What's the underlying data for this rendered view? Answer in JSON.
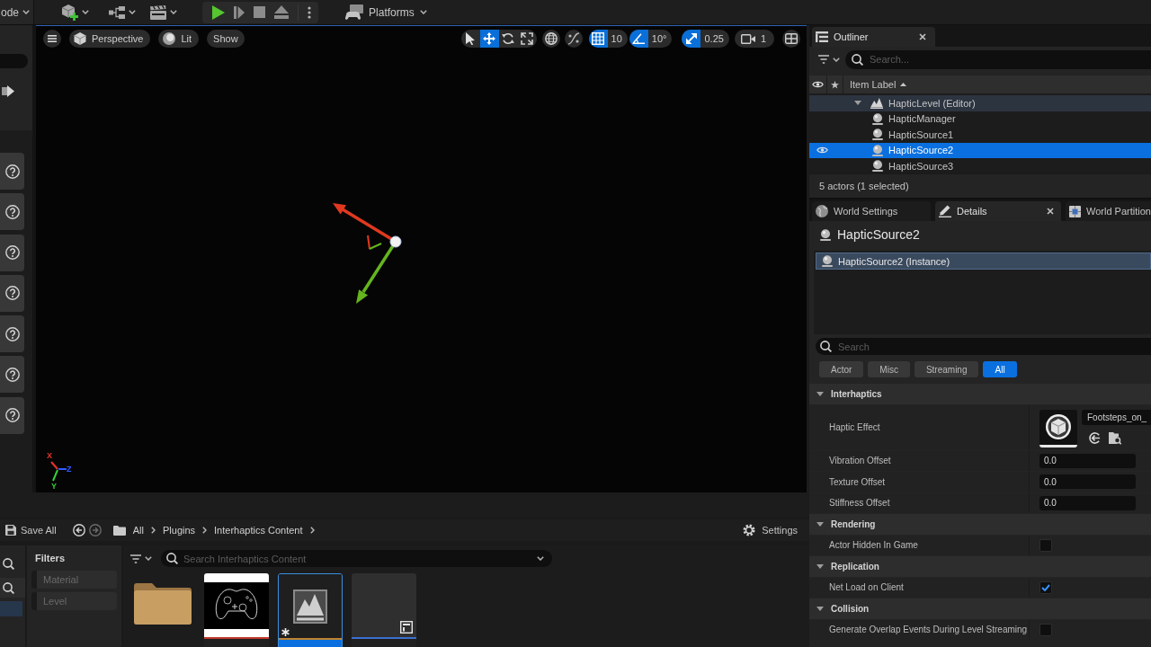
{
  "toolbar": {
    "mode_label": "ode",
    "platforms_label": "Platforms"
  },
  "place_actors": {
    "items": [
      {
        "kind": "help"
      },
      {
        "kind": "help"
      },
      {
        "kind": "help"
      },
      {
        "kind": "help"
      },
      {
        "kind": "help"
      },
      {
        "kind": "help"
      },
      {
        "kind": "help"
      }
    ]
  },
  "viewport": {
    "view_buttons": [
      {
        "kind": "perspective",
        "label": "Perspective"
      },
      {
        "kind": "lit",
        "label": "Lit"
      },
      {
        "kind": "show",
        "label": "Show"
      }
    ],
    "transform_tools": [
      {
        "kind": "select",
        "selected": false
      },
      {
        "kind": "translate",
        "selected": true
      },
      {
        "kind": "rotate",
        "selected": false
      },
      {
        "kind": "scale",
        "selected": false
      }
    ],
    "snaps": [
      {
        "kind": "grid",
        "on": true,
        "value": "10"
      },
      {
        "kind": "rotation",
        "on": true,
        "value": "10°"
      },
      {
        "kind": "scale",
        "on": true,
        "value": "0.25"
      }
    ],
    "camera_speed": "1",
    "axes": [
      {
        "label": "X",
        "color": "#e8322a"
      },
      {
        "label": "Z",
        "color": "#2f5bff"
      },
      {
        "label": "Y",
        "color": "#36d13a"
      }
    ]
  },
  "outliner": {
    "tabs": [
      {
        "label": "Outliner",
        "selected": true
      }
    ],
    "search": {
      "placeholder": "Search..."
    },
    "column": "Item Label",
    "sort_ascending": true,
    "tree": [
      {
        "label": "HapticLevel (Editor)",
        "kind": "level",
        "expanded": true,
        "selected": false,
        "children": [
          {
            "label": "HapticManager",
            "kind": "actor",
            "selected": false
          },
          {
            "label": "HapticSource1",
            "kind": "actor",
            "selected": false
          },
          {
            "label": "HapticSource2",
            "kind": "actor",
            "selected": true
          },
          {
            "label": "HapticSource3",
            "kind": "actor",
            "selected": false
          }
        ]
      }
    ],
    "status": "5 actors (1 selected)"
  },
  "details": {
    "tabs": [
      {
        "kind": "world_settings",
        "label": "World Settings",
        "selected": false
      },
      {
        "kind": "details",
        "label": "Details",
        "selected": true
      },
      {
        "kind": "world_partition",
        "label": "World Partition",
        "selected": false
      }
    ],
    "actor_name": "HapticSource2",
    "component": {
      "label": "HapticSource2 (Instance)",
      "selected": true
    },
    "search": {
      "placeholder": "Search"
    },
    "filters": [
      {
        "label": "Actor",
        "selected": false
      },
      {
        "label": "Misc",
        "selected": false
      },
      {
        "label": "Streaming",
        "selected": false
      },
      {
        "label": "All",
        "selected": true
      }
    ],
    "categories": [
      {
        "label": "Interhaptics",
        "expanded": true,
        "properties": [
          {
            "label": "Haptic Effect",
            "kind": "asset",
            "value": "Footsteps_on_"
          },
          {
            "label": "Vibration Offset",
            "kind": "number",
            "value": "0.0"
          },
          {
            "label": "Texture Offset",
            "kind": "number",
            "value": "0.0"
          },
          {
            "label": "Stiffness Offset",
            "kind": "number",
            "value": "0.0"
          }
        ]
      },
      {
        "label": "Rendering",
        "expanded": true,
        "properties": [
          {
            "label": "Actor Hidden In Game",
            "kind": "checkbox",
            "checked": false
          }
        ]
      },
      {
        "label": "Replication",
        "expanded": true,
        "properties": [
          {
            "label": "Net Load on Client",
            "kind": "checkbox",
            "checked": true
          }
        ]
      },
      {
        "label": "Collision",
        "expanded": true,
        "properties": [
          {
            "label": "Generate Overlap Events During Level Streaming",
            "kind": "checkbox",
            "checked": false
          }
        ]
      }
    ]
  },
  "content_browser": {
    "save_label": "Save All",
    "breadcrumb": [
      "All",
      "Plugins",
      "Interhaptics Content"
    ],
    "settings_label": "Settings",
    "sources": [
      {
        "selected": true
      }
    ],
    "filters_title": "Filters",
    "filters": [
      {
        "label": "Material",
        "active": false
      },
      {
        "label": "Level",
        "active": false
      }
    ],
    "search": {
      "placeholder": "Search Interhaptics Content"
    },
    "assets": [
      {
        "kind": "folder",
        "selected": false
      },
      {
        "kind": "texture",
        "selected": false,
        "color": "#c0392b"
      },
      {
        "kind": "level",
        "selected": true,
        "modified": true,
        "color": "#c08430"
      },
      {
        "kind": "widget",
        "selected": false,
        "color": "#3b6fcf"
      }
    ]
  }
}
